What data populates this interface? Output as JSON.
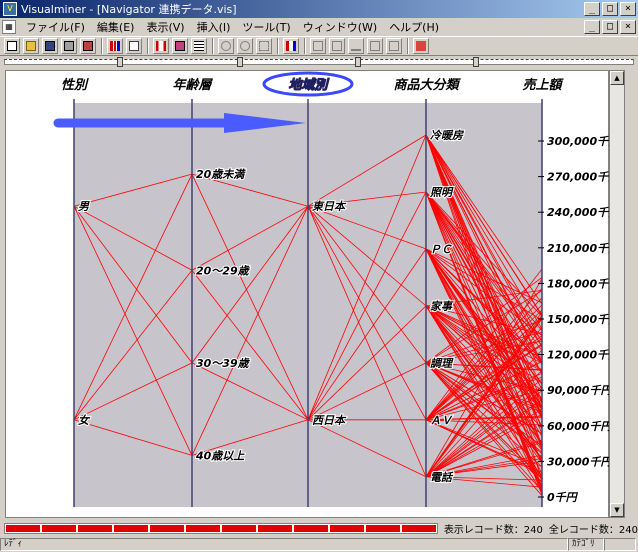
{
  "window": {
    "title": "Visualminer - [Navigator 連携データ.vis]",
    "minimize": "_",
    "maximize": "□",
    "close": "×"
  },
  "menu": {
    "items": [
      "ファイル(F)",
      "編集(E)",
      "表示(V)",
      "挿入(I)",
      "ツール(T)",
      "ウィンドウ(W)",
      "ヘルプ(H)"
    ]
  },
  "axes": [
    {
      "label": "性別",
      "highlighted": false,
      "categories": [
        {
          "label": "男",
          "pos": 0.2
        },
        {
          "label": "女",
          "pos": 0.8
        }
      ]
    },
    {
      "label": "年齢層",
      "highlighted": false,
      "categories": [
        {
          "label": "20歳未満",
          "pos": 0.11
        },
        {
          "label": "20～29歳",
          "pos": 0.38
        },
        {
          "label": "30～39歳",
          "pos": 0.64
        },
        {
          "label": "40歳以上",
          "pos": 0.9
        }
      ]
    },
    {
      "label": "地域別",
      "highlighted": true,
      "categories": [
        {
          "label": "東日本",
          "pos": 0.2
        },
        {
          "label": "西日本",
          "pos": 0.8
        }
      ]
    },
    {
      "label": "商品大分類",
      "highlighted": false,
      "categories": [
        {
          "label": "冷暖房",
          "pos": 0.0
        },
        {
          "label": "照明",
          "pos": 0.16
        },
        {
          "label": "ＰＣ",
          "pos": 0.32
        },
        {
          "label": "家事",
          "pos": 0.48
        },
        {
          "label": "調理",
          "pos": 0.64
        },
        {
          "label": "ＡＶ",
          "pos": 0.8
        },
        {
          "label": "電話",
          "pos": 0.96
        }
      ]
    },
    {
      "label": "売上額",
      "highlighted": false,
      "ticks": [
        "300,000千円",
        "270,000千円",
        "240,000千円",
        "210,000千円",
        "180,000千円",
        "150,000千円",
        "120,000千円",
        "90,000千円",
        "60,000千円",
        "30,000千円",
        "0千円"
      ]
    }
  ],
  "colors": {
    "plot_bg": "#c8c4cc",
    "line": "#ff0000",
    "axis": "#404070",
    "highlight": "#3a48ff",
    "arrow": "#4a5cff"
  },
  "status": {
    "displayed_records": "表示レコード数：240",
    "total_records": "全レコード数：240",
    "ready": "ﾚﾃﾞｨ",
    "category": "ｶﾃｺﾞﾘ"
  }
}
